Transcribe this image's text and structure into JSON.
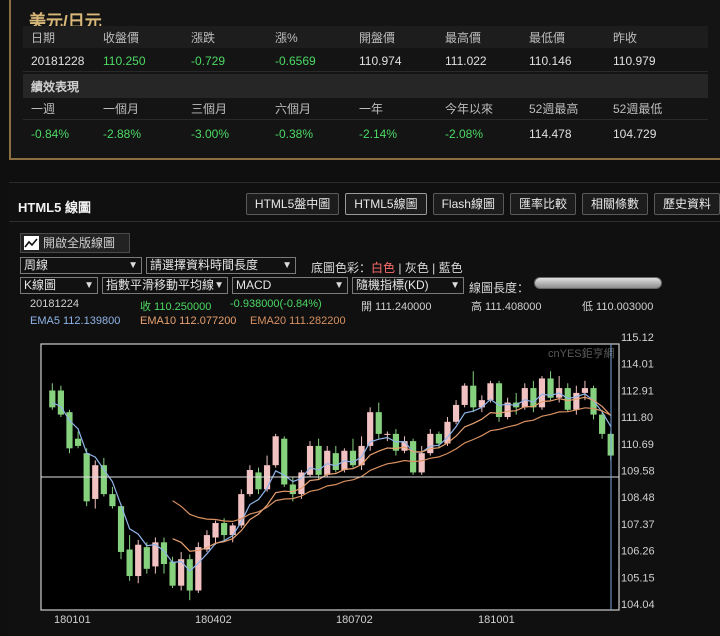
{
  "quote": {
    "title": "美元/日元",
    "headers": [
      "日期",
      "收盤價",
      "漲跌",
      "漲%",
      "開盤價",
      "最高價",
      "最低價",
      "昨收"
    ],
    "values": [
      "20181228",
      "110.250",
      "-0.729",
      "-0.6569",
      "110.974",
      "111.022",
      "110.146",
      "110.979"
    ],
    "perf_title": "績效表現",
    "perf_headers": [
      "一週",
      "一個月",
      "三個月",
      "六個月",
      "一年",
      "今年以來",
      "52週最高",
      "52週最低"
    ],
    "perf_values": [
      "-0.84%",
      "-2.88%",
      "-3.00%",
      "-0.38%",
      "-2.14%",
      "-2.08%",
      "114.478",
      "104.729"
    ]
  },
  "chart_panel": {
    "title": "HTML5 線圖",
    "buttons": [
      "HTML5盤中圖",
      "HTML5線圖",
      "Flash線圖",
      "匯率比較",
      "相關條數",
      "歷史資料"
    ],
    "full_button": "開啟全版線圖",
    "period_select": "周線",
    "range_select": "請選擇資料時間長度",
    "bg_label": "底圖色彩：",
    "bg_options": [
      "白色",
      "灰色",
      "藍色"
    ],
    "type_select": "K線圖",
    "ma_select": "指數平滑移動平均線",
    "macd_select": "MACD",
    "kd_select": "隨機指標(KD)",
    "length_label": "線圖長度：",
    "info_date": "20181224",
    "info_close": "收 110.250000",
    "info_change": "-0.938000(-0.84%)",
    "info_open": "開 111.240000",
    "info_high": "高 111.408000",
    "info_low": "低 110.003000",
    "ema5": "EMA5 112.139800",
    "ema10": "EMA10 112.077200",
    "ema20": "EMA20 111.282200",
    "watermark": "cnYES鉅亨網"
  },
  "colors": {
    "up": "#f2c1c1",
    "down": "#86d17e",
    "ema5": "#8fb4e8",
    "ema10": "#e8a070",
    "ema20": "#d89060",
    "accent": "#d9b97a"
  },
  "chart_data": {
    "type": "candlestick",
    "ylim": [
      104.04,
      115.12
    ],
    "yticks": [
      "115.12",
      "114.01",
      "112.91",
      "111.80",
      "110.69",
      "109.58",
      "108.48",
      "107.37",
      "106.26",
      "105.15",
      "104.04"
    ],
    "xticks": [
      "180101",
      "180402",
      "180702",
      "181001"
    ],
    "candles": [
      [
        112.9,
        112.2,
        113.2,
        112.1
      ],
      [
        112.9,
        111.9,
        113.1,
        111.8
      ],
      [
        112.0,
        110.5,
        112.1,
        110.3
      ],
      [
        110.9,
        110.6,
        111.2,
        110.5
      ],
      [
        110.3,
        108.3,
        110.5,
        108.1
      ],
      [
        108.4,
        109.8,
        110.0,
        108.0
      ],
      [
        109.8,
        108.6,
        110.1,
        108.5
      ],
      [
        108.6,
        108.1,
        108.9,
        108.0
      ],
      [
        108.1,
        106.2,
        108.2,
        105.9
      ],
      [
        106.3,
        105.2,
        106.9,
        105.0
      ],
      [
        105.2,
        106.5,
        106.7,
        104.9
      ],
      [
        106.4,
        105.5,
        106.6,
        105.3
      ],
      [
        105.6,
        106.6,
        106.8,
        105.3
      ],
      [
        106.6,
        105.7,
        106.8,
        105.3
      ],
      [
        105.8,
        104.8,
        106.0,
        104.7
      ],
      [
        104.8,
        105.9,
        106.2,
        104.6
      ],
      [
        105.9,
        104.6,
        106.1,
        104.2
      ],
      [
        104.6,
        106.4,
        106.6,
        104.5
      ],
      [
        106.3,
        106.9,
        107.1,
        106.2
      ],
      [
        106.8,
        107.4,
        107.5,
        106.5
      ],
      [
        107.4,
        106.9,
        107.6,
        106.7
      ],
      [
        106.9,
        107.3,
        107.4,
        106.6
      ],
      [
        107.3,
        108.6,
        108.8,
        107.2
      ],
      [
        108.6,
        109.6,
        109.8,
        108.5
      ],
      [
        109.5,
        108.8,
        109.7,
        108.6
      ],
      [
        108.8,
        109.8,
        110.2,
        108.7
      ],
      [
        109.8,
        111.0,
        111.1,
        109.7
      ],
      [
        110.9,
        109.0,
        111.0,
        108.9
      ],
      [
        109.0,
        108.6,
        109.3,
        108.3
      ],
      [
        108.6,
        109.5,
        109.6,
        108.4
      ],
      [
        109.4,
        110.6,
        110.8,
        109.3
      ],
      [
        110.6,
        109.4,
        110.9,
        109.2
      ],
      [
        109.4,
        110.4,
        110.6,
        109.3
      ],
      [
        110.3,
        109.6,
        110.6,
        109.5
      ],
      [
        109.6,
        110.4,
        110.5,
        109.5
      ],
      [
        110.4,
        109.8,
        110.9,
        109.7
      ],
      [
        109.8,
        110.6,
        111.0,
        109.6
      ],
      [
        110.6,
        112.0,
        112.2,
        110.4
      ],
      [
        112.0,
        111.1,
        112.4,
        110.9
      ],
      [
        111.1,
        111.1,
        111.2,
        110.8
      ],
      [
        111.1,
        110.4,
        111.3,
        110.2
      ],
      [
        110.4,
        110.8,
        111.0,
        110.3
      ],
      [
        110.8,
        109.5,
        110.9,
        109.4
      ],
      [
        109.5,
        110.3,
        110.6,
        109.4
      ],
      [
        110.3,
        111.1,
        111.3,
        110.2
      ],
      [
        111.1,
        110.7,
        111.2,
        110.5
      ],
      [
        110.7,
        111.6,
        111.8,
        110.6
      ],
      [
        111.6,
        112.3,
        112.5,
        111.5
      ],
      [
        112.3,
        113.1,
        113.2,
        112.2
      ],
      [
        113.1,
        112.2,
        113.7,
        112.0
      ],
      [
        112.2,
        112.5,
        112.7,
        112.0
      ],
      [
        112.5,
        113.2,
        113.3,
        112.4
      ],
      [
        113.2,
        111.8,
        113.3,
        111.6
      ],
      [
        111.8,
        112.4,
        112.6,
        111.7
      ],
      [
        112.4,
        112.2,
        112.8,
        111.9
      ],
      [
        112.2,
        113.0,
        113.2,
        112.1
      ],
      [
        113.0,
        112.2,
        113.3,
        112.0
      ],
      [
        112.2,
        113.4,
        113.5,
        112.1
      ],
      [
        113.4,
        112.6,
        113.7,
        112.5
      ],
      [
        112.6,
        113.0,
        113.5,
        112.4
      ],
      [
        113.0,
        112.1,
        113.2,
        112.0
      ],
      [
        112.1,
        112.8,
        113.1,
        111.9
      ],
      [
        112.8,
        113.0,
        113.3,
        112.5
      ],
      [
        113.0,
        111.9,
        113.1,
        111.7
      ],
      [
        111.9,
        111.1,
        112.1,
        110.9
      ],
      [
        111.1,
        110.2,
        111.2,
        110.0
      ]
    ]
  }
}
